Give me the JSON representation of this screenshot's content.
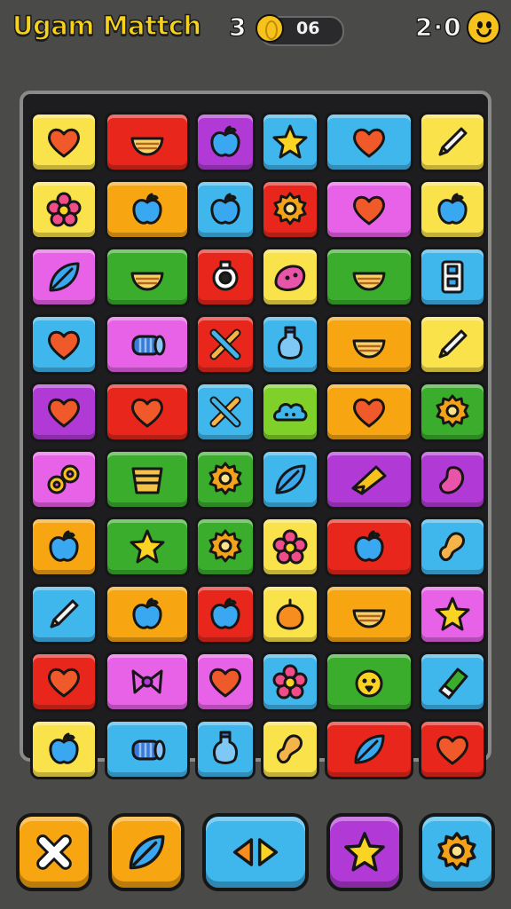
{
  "header": {
    "title": "Ugam Mattch",
    "level": "3",
    "coins": "06",
    "score": "2·0"
  },
  "colors": {
    "background": "#4a4a48",
    "title": "#f7d21c",
    "yellow": "#f9e24a",
    "red": "#e8261c",
    "purple": "#b13ad6",
    "cyan": "#3fb6ec",
    "pink": "#e862e8",
    "green": "#3aae2c",
    "orange": "#f7a612",
    "lime": "#7fd12a"
  },
  "board": {
    "rows": [
      [
        {
          "color": "yellow",
          "icon": "heart-icon"
        },
        {
          "color": "red",
          "icon": "bowl-icon"
        },
        {
          "color": "purple",
          "icon": "apple-icon"
        },
        {
          "color": "cyan",
          "icon": "star-icon"
        },
        {
          "color": "cyan",
          "icon": "heart-icon"
        },
        {
          "color": "yellow",
          "icon": "pencil-icon"
        }
      ],
      [
        {
          "color": "yellow",
          "icon": "flower-icon"
        },
        {
          "color": "orange",
          "icon": "apple-icon"
        },
        {
          "color": "cyan",
          "icon": "apple-icon"
        },
        {
          "color": "red",
          "icon": "gear-icon"
        },
        {
          "color": "pink",
          "icon": "heart-icon"
        },
        {
          "color": "yellow",
          "icon": "apple-icon"
        }
      ],
      [
        {
          "color": "pink",
          "icon": "leaf-icon"
        },
        {
          "color": "green",
          "icon": "bowl-icon"
        },
        {
          "color": "red",
          "icon": "ring-icon"
        },
        {
          "color": "yellow",
          "icon": "blob-icon"
        },
        {
          "color": "green",
          "icon": "bowl-icon"
        },
        {
          "color": "cyan",
          "icon": "block-icon"
        }
      ],
      [
        {
          "color": "cyan",
          "icon": "heart-icon"
        },
        {
          "color": "pink",
          "icon": "scroll-icon"
        },
        {
          "color": "red",
          "icon": "cross-sticks-icon"
        },
        {
          "color": "cyan",
          "icon": "bottle-icon"
        },
        {
          "color": "orange",
          "icon": "bowl-icon"
        },
        {
          "color": "yellow",
          "icon": "pencil-icon"
        }
      ],
      [
        {
          "color": "purple",
          "icon": "heart-icon"
        },
        {
          "color": "red",
          "icon": "heart-icon"
        },
        {
          "color": "cyan",
          "icon": "cross-sticks-icon"
        },
        {
          "color": "lime",
          "icon": "cloud-icon"
        },
        {
          "color": "orange",
          "icon": "heart-icon"
        },
        {
          "color": "green",
          "icon": "gear-icon"
        }
      ],
      [
        {
          "color": "pink",
          "icon": "chain-icon"
        },
        {
          "color": "green",
          "icon": "basket-icon"
        },
        {
          "color": "green",
          "icon": "gear-icon"
        },
        {
          "color": "cyan",
          "icon": "leaf-icon"
        },
        {
          "color": "purple",
          "icon": "cheese-icon"
        },
        {
          "color": "purple",
          "icon": "bean-icon"
        }
      ],
      [
        {
          "color": "orange",
          "icon": "apple-icon"
        },
        {
          "color": "green",
          "icon": "star-icon"
        },
        {
          "color": "green",
          "icon": "gear-icon"
        },
        {
          "color": "yellow",
          "icon": "flower-icon"
        },
        {
          "color": "red",
          "icon": "apple-icon"
        },
        {
          "color": "cyan",
          "icon": "peanut-icon"
        }
      ],
      [
        {
          "color": "cyan",
          "icon": "pencil-icon"
        },
        {
          "color": "orange",
          "icon": "apple-icon"
        },
        {
          "color": "red",
          "icon": "apple-icon"
        },
        {
          "color": "yellow",
          "icon": "orange-fruit-icon"
        },
        {
          "color": "orange",
          "icon": "bowl-icon"
        },
        {
          "color": "pink",
          "icon": "star-icon"
        }
      ],
      [
        {
          "color": "red",
          "icon": "heart-icon"
        },
        {
          "color": "pink",
          "icon": "bow-icon"
        },
        {
          "color": "pink",
          "icon": "heart-icon"
        },
        {
          "color": "cyan",
          "icon": "flower-icon"
        },
        {
          "color": "green",
          "icon": "chick-icon"
        },
        {
          "color": "cyan",
          "icon": "eraser-icon"
        }
      ],
      [
        {
          "color": "yellow",
          "icon": "apple-icon"
        },
        {
          "color": "cyan",
          "icon": "scroll-icon"
        },
        {
          "color": "cyan",
          "icon": "bottle-icon"
        },
        {
          "color": "yellow",
          "icon": "peanut-icon"
        },
        {
          "color": "red",
          "icon": "leaf-icon"
        },
        {
          "color": "red",
          "icon": "heart-icon"
        }
      ]
    ]
  },
  "toolbar": [
    {
      "name": "close-button",
      "color": "orange",
      "icon": "close-icon"
    },
    {
      "name": "leaf-button",
      "color": "orange",
      "icon": "leaf-icon"
    },
    {
      "name": "swap-button",
      "color": "cyan",
      "icon": "swap-arrows-icon"
    },
    {
      "name": "star-button",
      "color": "purple",
      "icon": "star-icon"
    },
    {
      "name": "settings-button",
      "color": "cyan",
      "icon": "gear-icon"
    }
  ]
}
